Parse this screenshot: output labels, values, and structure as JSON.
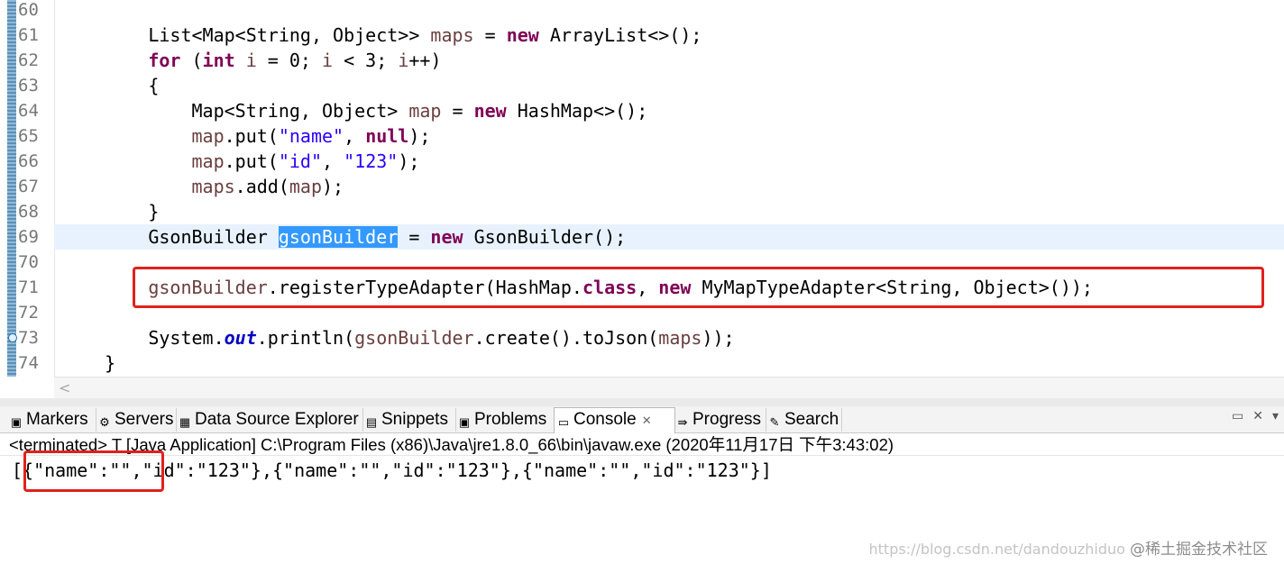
{
  "editor": {
    "line_numbers": [
      "60",
      "61",
      "62",
      "63",
      "64",
      "65",
      "66",
      "67",
      "68",
      "69",
      "70",
      "71",
      "72",
      "73",
      "74"
    ],
    "lines": [
      {
        "indent": ""
      },
      {
        "indent": "        ",
        "p1": "List<Map<String, Object>> ",
        "v1": "maps",
        "p2": " = ",
        "k1": "new",
        "p3": " ArrayList<>();"
      },
      {
        "indent": "        ",
        "k1": "for",
        "p1": " (",
        "k2": "int",
        "p2": " ",
        "v1": "i",
        "p3": " = 0; ",
        "v2": "i",
        "p4": " < 3; ",
        "v3": "i",
        "p5": "++)"
      },
      {
        "indent": "        ",
        "p1": "{"
      },
      {
        "indent": "            ",
        "p1": "Map<String, Object> ",
        "v1": "map",
        "p2": " = ",
        "k1": "new",
        "p3": " HashMap<>();"
      },
      {
        "indent": "            ",
        "v1": "map",
        "p1": ".put(",
        "s1": "\"name\"",
        "p2": ", ",
        "k1": "null",
        "p3": ");"
      },
      {
        "indent": "            ",
        "v1": "map",
        "p1": ".put(",
        "s1": "\"id\"",
        "p2": ", ",
        "s2": "\"123\"",
        "p3": ");"
      },
      {
        "indent": "            ",
        "v1": "maps",
        "p1": ".add(",
        "v2": "map",
        "p2": ");"
      },
      {
        "indent": "        ",
        "p1": "}"
      },
      {
        "indent": "        ",
        "p1": "GsonBuilder ",
        "sel": "gsonBuilder",
        "p2": " = ",
        "k1": "new",
        "p3": " GsonBuilder();"
      },
      {
        "indent": ""
      },
      {
        "indent": "        ",
        "v1": "gsonBuilder",
        "p1": ".registerTypeAdapter(HashMap.",
        "k1": "class",
        "p2": ", ",
        "k2": "new",
        "p3": " MyMapTypeAdapter<String, Object>());"
      },
      {
        "indent": ""
      },
      {
        "indent": "        ",
        "p1": "System.",
        "f1": "out",
        "p2": ".println(",
        "v1": "gsonBuilder",
        "p3": ".create().toJson(",
        "v2": "maps",
        "p4": "));"
      },
      {
        "indent": "    ",
        "p1": "}"
      }
    ]
  },
  "views": {
    "tabs": [
      {
        "label": "Markers",
        "icon": "markers-icon",
        "glyph": "▣"
      },
      {
        "label": "Servers",
        "icon": "servers-icon",
        "glyph": "⚙"
      },
      {
        "label": "Data Source Explorer",
        "icon": "data-source-icon",
        "glyph": "▦"
      },
      {
        "label": "Snippets",
        "icon": "snippets-icon",
        "glyph": "▤"
      },
      {
        "label": "Problems",
        "icon": "problems-icon",
        "glyph": "▣"
      },
      {
        "label": "Console",
        "icon": "console-icon",
        "glyph": "▭",
        "active": true,
        "close": "✕"
      },
      {
        "label": "Progress",
        "icon": "progress-icon",
        "glyph": "⇛"
      },
      {
        "label": "Search",
        "icon": "search-icon",
        "glyph": "✎"
      }
    ],
    "minimize": "▭",
    "maximize": "✕",
    "overflow": "▾"
  },
  "console": {
    "header": "<terminated> T [Java Application] C:\\Program Files (x86)\\Java\\jre1.8.0_66\\bin\\javaw.exe (2020年11月17日 下午3:43:02)",
    "output": "[{\"name\":\"\",\"id\":\"123\"},{\"name\":\"\",\"id\":\"123\"},{\"name\":\"\",\"id\":\"123\"}]"
  },
  "watermark": {
    "url": "https://blog.csdn.net/dandouzhiduo",
    "logo": "@稀土掘金技术社区"
  },
  "colors": {
    "keyword": "#7f0055",
    "variable": "#6a3e3e",
    "string": "#2a00ff",
    "static_field": "#0000c0",
    "selection": "#3399ff",
    "current_line": "#e8f2fe",
    "highlight_box": "#e0211d"
  }
}
